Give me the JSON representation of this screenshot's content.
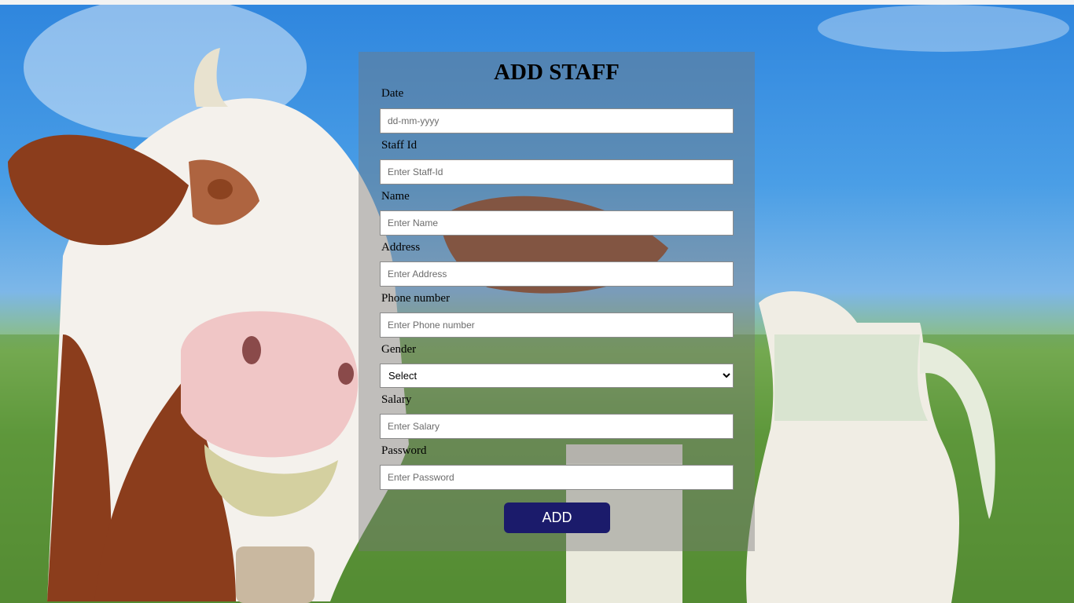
{
  "form": {
    "title": "ADD STAFF",
    "fields": [
      {
        "label": "Date",
        "placeholder": "dd-mm-yyyy"
      },
      {
        "label": "Staff Id",
        "placeholder": "Enter Staff-Id"
      },
      {
        "label": "Name",
        "placeholder": "Enter Name"
      },
      {
        "label": "Address",
        "placeholder": "Enter Address"
      },
      {
        "label": "Phone number",
        "placeholder": "Enter Phone number"
      },
      {
        "label": "Gender",
        "selected": "Select"
      },
      {
        "label": "Salary",
        "placeholder": "Enter Salary"
      },
      {
        "label": "Password",
        "placeholder": "Enter Password"
      }
    ],
    "submit_label": "ADD"
  },
  "colors": {
    "button": "#1b1b6b",
    "panel": "rgba(120,120,120,0.42)"
  }
}
